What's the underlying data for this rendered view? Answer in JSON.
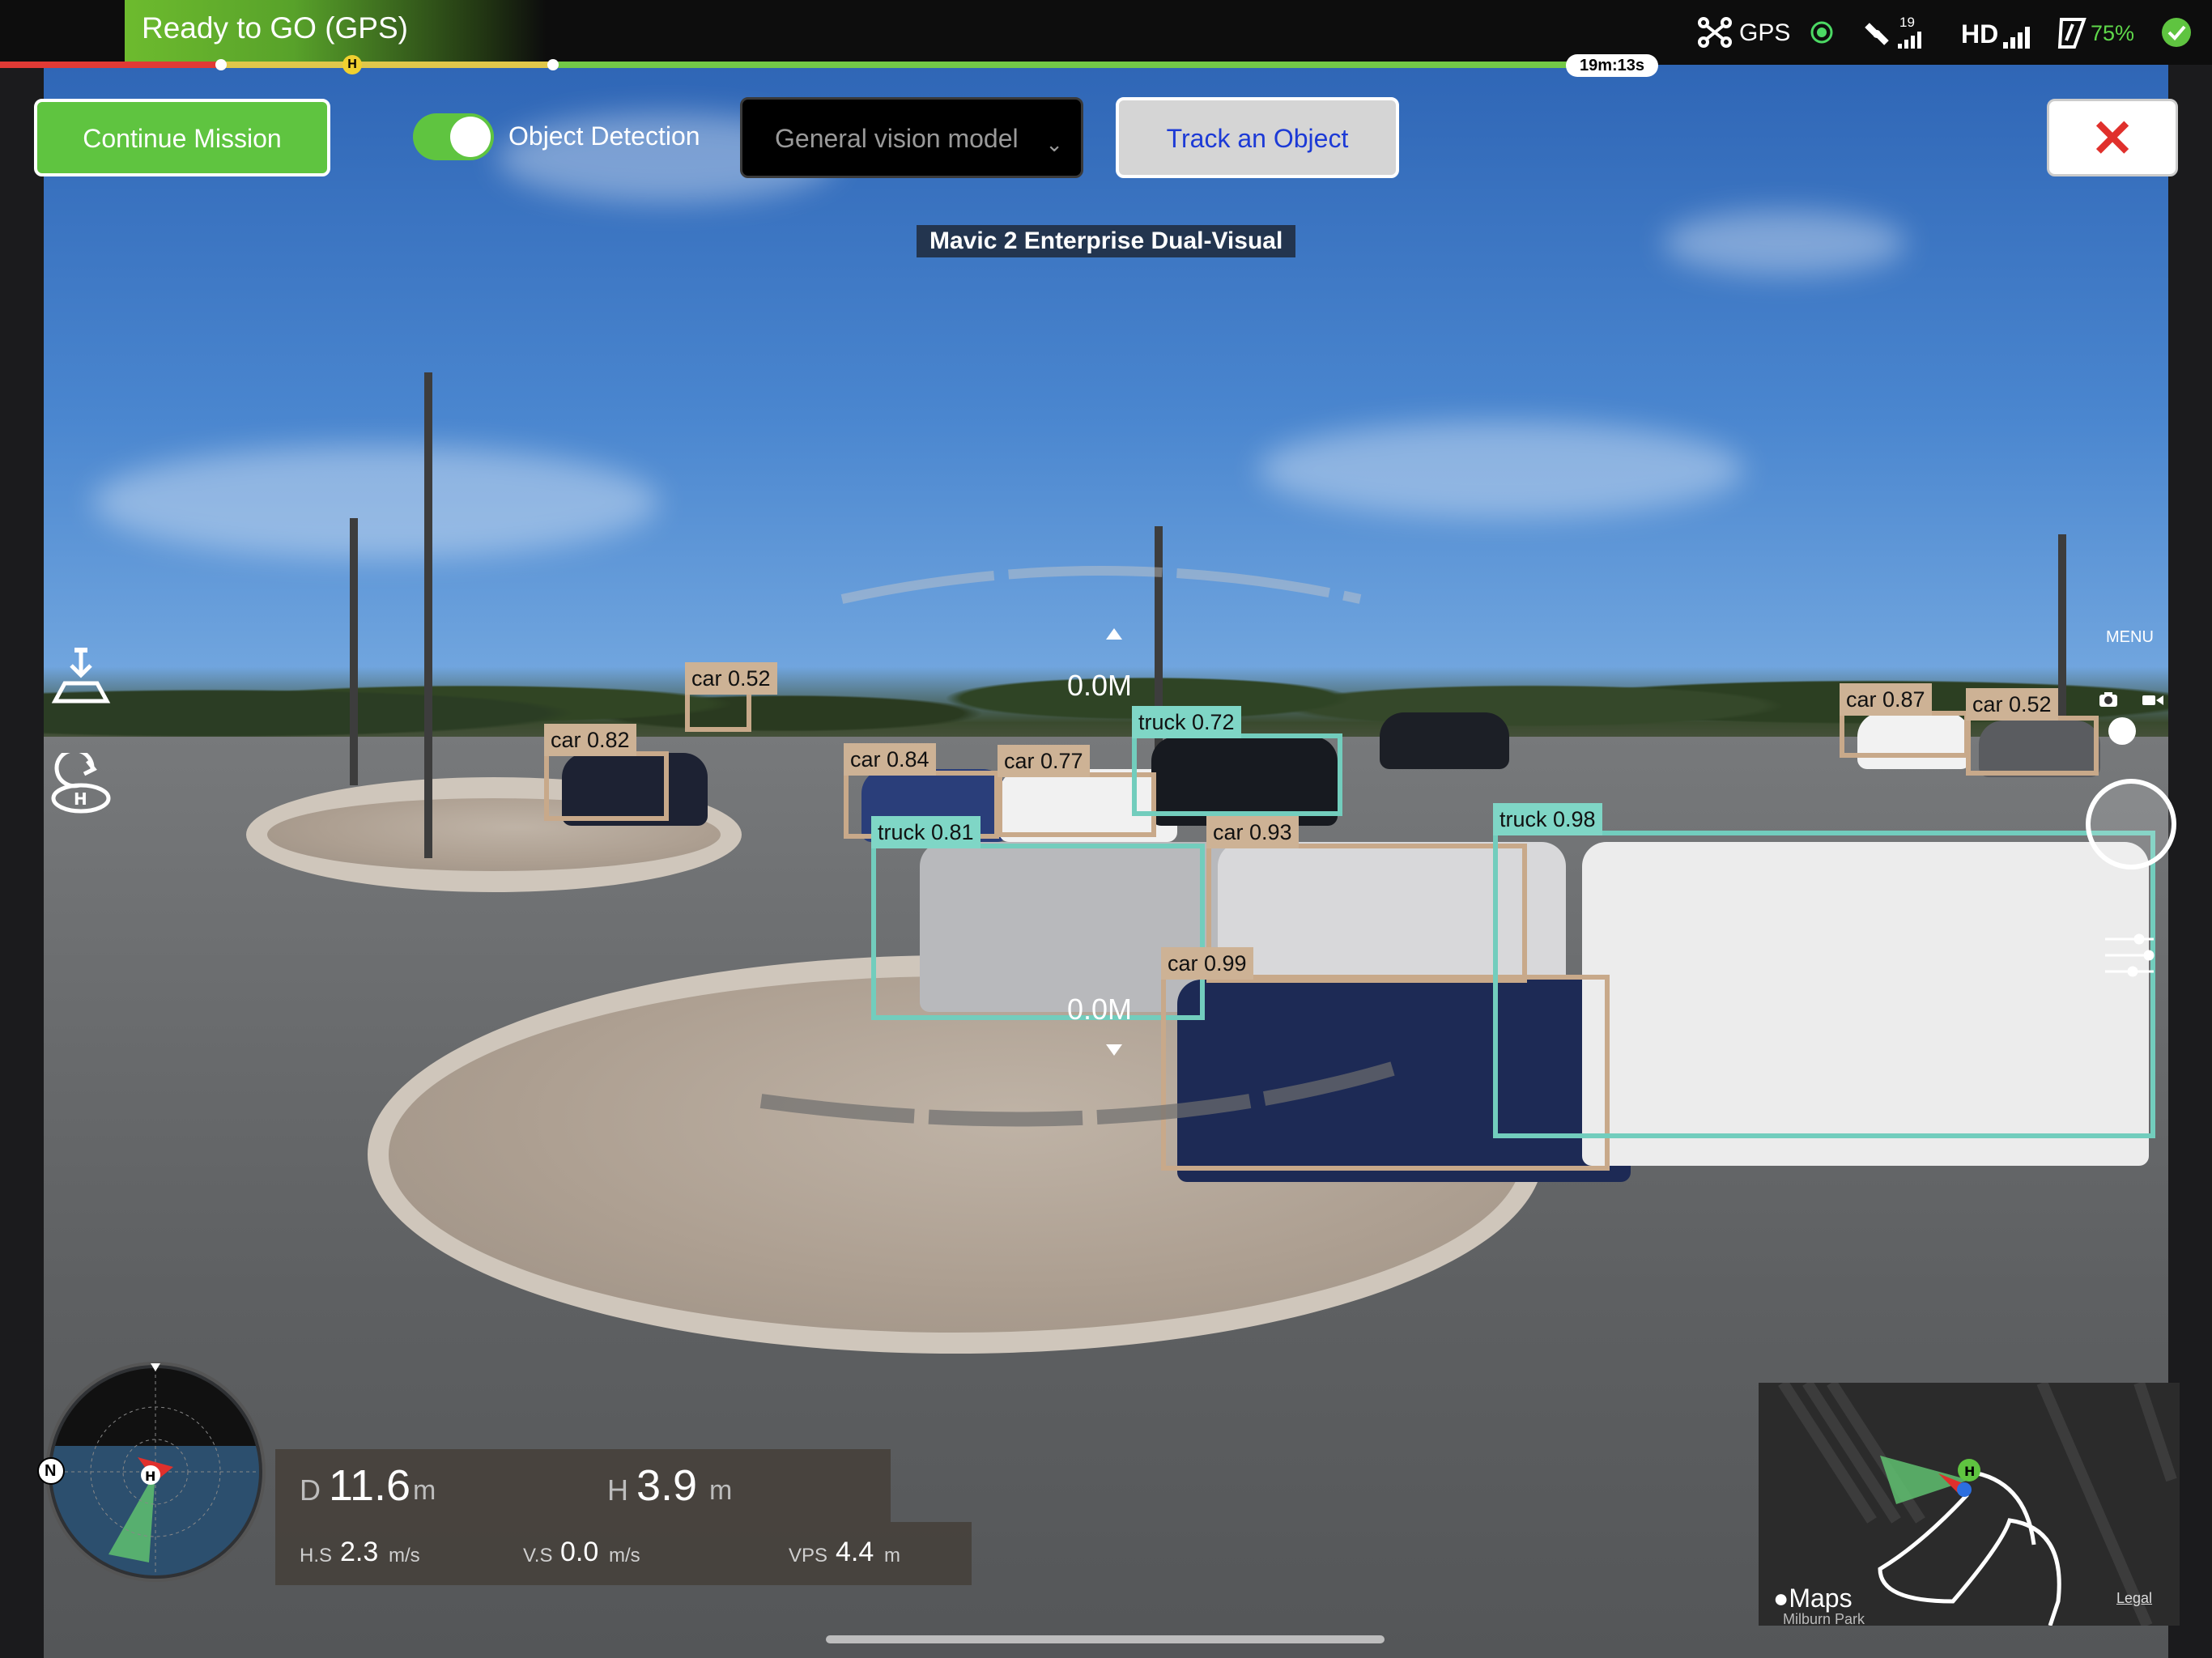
{
  "status": {
    "flight_status": "Ready to GO (GPS)",
    "home_marker": "H",
    "remaining_time": "19m:13s",
    "gps_label": "GPS",
    "satellite_count": "19",
    "video_link": "HD",
    "battery": "75%",
    "mission_progress": {
      "red_fraction": 0.1,
      "yellow_fraction": 0.15,
      "green_fraction": 0.48
    }
  },
  "controls": {
    "continue_mission": "Continue Mission",
    "object_detection_label": "Object Detection",
    "object_detection_enabled": true,
    "model_select_value": "General vision model",
    "track_object": "Track an Object",
    "close_symbol": "✕"
  },
  "camera": {
    "name": "Mavic 2 Enterprise Dual-Visual",
    "menu_label": "MENU",
    "gimbal_top_distance": "0.0M",
    "gimbal_bottom_distance": "0.0M"
  },
  "detections": [
    {
      "label": "car 0.52",
      "class": "car"
    },
    {
      "label": "car 0.82",
      "class": "car"
    },
    {
      "label": "car 0.84",
      "class": "car"
    },
    {
      "label": "car 0.77",
      "class": "car"
    },
    {
      "label": "truck 0.72",
      "class": "truck"
    },
    {
      "label": "truck 0.81",
      "class": "truck"
    },
    {
      "label": "car 0.93",
      "class": "car"
    },
    {
      "label": "car 0.99",
      "class": "car"
    },
    {
      "label": "truck 0.98",
      "class": "truck"
    },
    {
      "label": "car 0.87",
      "class": "car"
    },
    {
      "label": "car 0.52",
      "class": "car"
    }
  ],
  "telemetry": {
    "distance_label": "D",
    "distance_value": "11.6",
    "distance_unit": "m",
    "height_label": "H",
    "height_value": "3.9",
    "height_unit": "m",
    "hs_label": "H.S",
    "hs_value": "2.3",
    "hs_unit": "m/s",
    "vs_label": "V.S",
    "vs_value": "0.0",
    "vs_unit": "m/s",
    "vps_label": "VPS",
    "vps_value": "4.4",
    "vps_unit": "m"
  },
  "radar": {
    "north_label": "N",
    "home_label": "H"
  },
  "map": {
    "logo": "Maps",
    "legal": "Legal",
    "place": "Milburn Park",
    "home_label": "H"
  },
  "icons": [
    "drone-icon",
    "signal-icon",
    "satellite-icon",
    "rc-signal-icon",
    "battery-icon",
    "ok-check-icon",
    "download-icon",
    "return-home-icon",
    "photo-icon",
    "video-icon",
    "settings-sliders-icon"
  ],
  "colors": {
    "accent_green": "#5fc440",
    "car_box": "#c8a98a",
    "truck_box": "#72cdbd",
    "track_text": "#1c3ad6",
    "close_red": "#e0302c"
  }
}
